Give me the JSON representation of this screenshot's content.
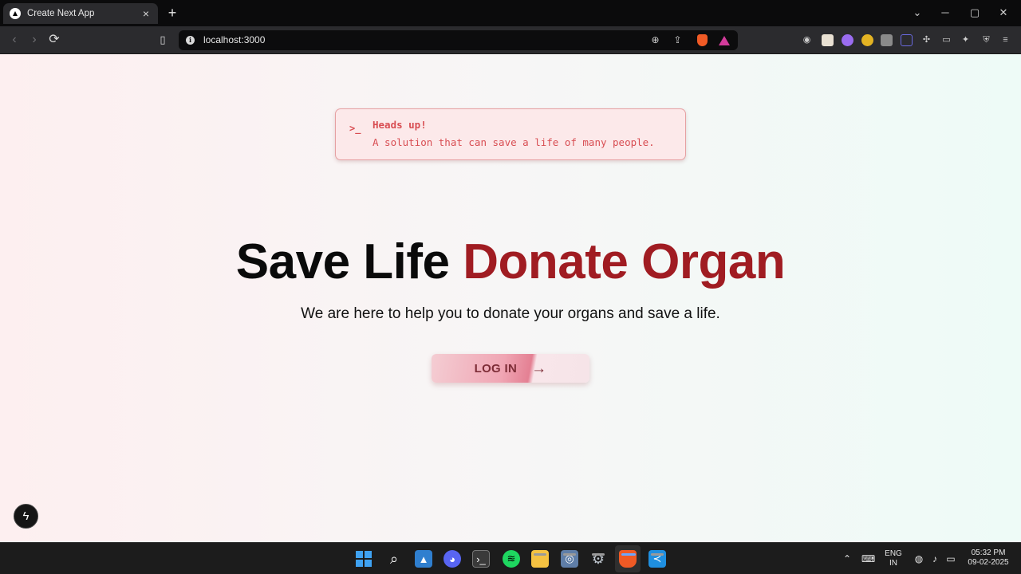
{
  "browser": {
    "tab_title": "Create Next App",
    "tab_close": "×",
    "new_tab": "+",
    "url": "localhost:3000"
  },
  "window_controls": {
    "dropdown": "⌄",
    "minimize": "─",
    "maximize": "▢",
    "close": "✕"
  },
  "alert": {
    "icon": ">_",
    "title": "Heads up!",
    "description": "A solution that can save a life of many people."
  },
  "hero": {
    "title_part1": "Save Life",
    "title_part2": "Donate Organ",
    "subtitle": "We are here to help you to donate your organs and save a life."
  },
  "login_button": {
    "label": "LOG IN",
    "arrow": "→"
  },
  "taskbar": {
    "language_line1": "ENG",
    "language_line2": "IN",
    "time": "05:32 PM",
    "date": "09-02-2025"
  },
  "colors": {
    "accent_red": "#a01c22",
    "alert_text": "#d84d52"
  }
}
